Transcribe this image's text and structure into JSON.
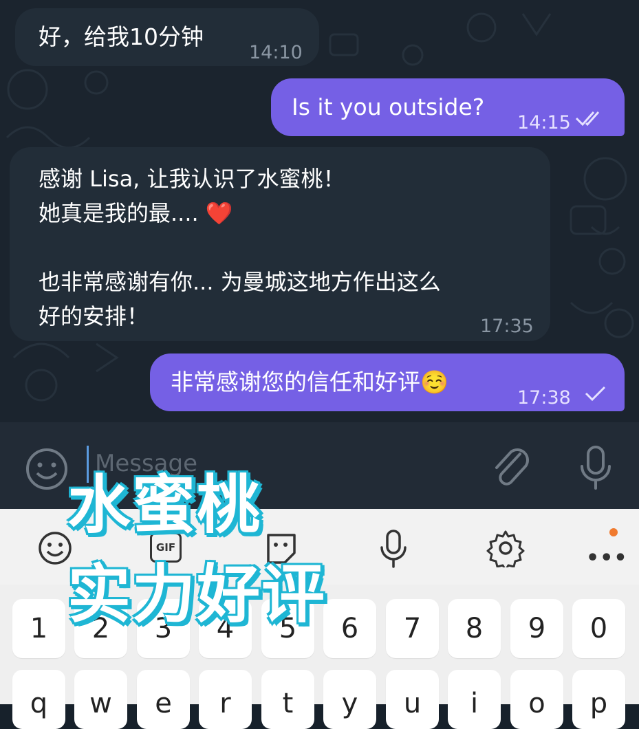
{
  "colors": {
    "chat_bg": "#1b242e",
    "incoming_bubble": "#222d38",
    "outgoing_bubble": "#7560e5",
    "input_bar": "#222b36",
    "keyboard_bg": "#efefef",
    "overlay_accent": "#1fb6d4"
  },
  "messages": [
    {
      "direction": "incoming",
      "text": "好，给我10分钟",
      "time": "14:10"
    },
    {
      "direction": "outgoing",
      "text": "Is it you outside?",
      "time": "14:15",
      "status": "read"
    },
    {
      "direction": "incoming",
      "text": "感谢 Lisa, 让我认识了水蜜桃！\n她真是我的最.... ❤️\n\n也非常感谢有你... 为曼城这地方作出这么\n好的安排！",
      "time": "17:35"
    },
    {
      "direction": "outgoing",
      "text": "非常感谢您的信任和好评☺️",
      "time": "17:38",
      "status": "sent"
    }
  ],
  "input": {
    "placeholder": "Message",
    "emoji_icon": "smile-icon",
    "attach_icon": "paperclip-icon",
    "mic_icon": "microphone-icon"
  },
  "keyboard": {
    "toolbar": [
      "emoji-icon",
      "gif-icon",
      "sticker-icon",
      "microphone-icon",
      "settings-icon",
      "more-icon"
    ],
    "gif_label": "GIF",
    "number_row": [
      "1",
      "2",
      "3",
      "4",
      "5",
      "6",
      "7",
      "8",
      "9",
      "0"
    ],
    "letter_row": [
      "q",
      "w",
      "e",
      "r",
      "t",
      "y",
      "u",
      "i",
      "o",
      "p"
    ]
  },
  "overlay": {
    "line1": "水蜜桃",
    "line2": "实力好评"
  }
}
